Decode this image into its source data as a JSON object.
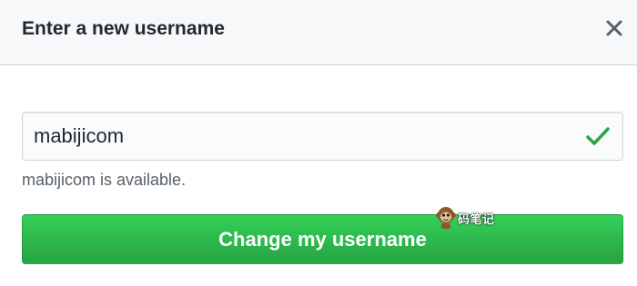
{
  "dialog": {
    "title": "Enter a new username",
    "close_icon": "close-icon"
  },
  "form": {
    "username_value": "mabijicom",
    "status_icon": "check-icon",
    "availability_message": "mabijicom is available.",
    "submit_label": "Change my username"
  },
  "watermark": {
    "text": "码笔记",
    "mark_icon": "monkey-mascot-icon"
  },
  "colors": {
    "header_background": "#f6f8fa",
    "title_text": "#24292e",
    "note_text": "#586069",
    "success_green": "#28a745",
    "check_green": "#28a745",
    "button_gradient_top": "#34d058",
    "button_gradient_bottom": "#28a745"
  }
}
